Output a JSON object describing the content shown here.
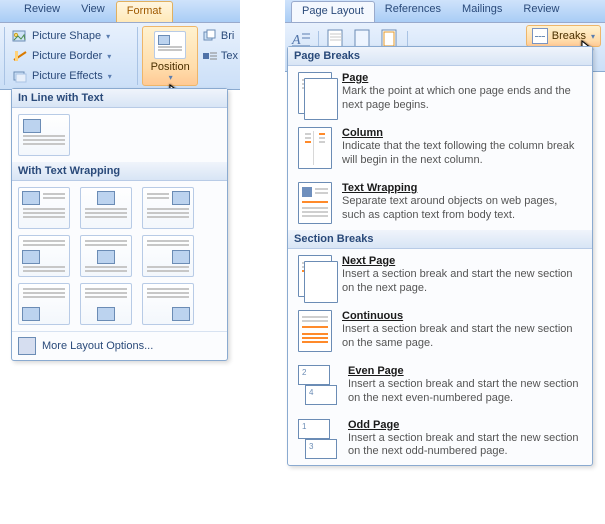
{
  "left": {
    "tabs": {
      "review": "Review",
      "view": "View",
      "format": "Format"
    },
    "picture": {
      "shape": "Picture Shape",
      "border": "Picture Border",
      "effects": "Picture Effects"
    },
    "position_btn": "Position",
    "trail": {
      "bri": "Bri",
      "tex": "Tex"
    },
    "panel": {
      "inline": "In Line with Text",
      "wrap": "With Text Wrapping",
      "more": "More Layout Options..."
    }
  },
  "right": {
    "tabs": {
      "page_layout": "Page Layout",
      "references": "References",
      "mailings": "Mailings",
      "review": "Review"
    },
    "breaks_btn": "Breaks",
    "groups": {
      "page_breaks": "Page Breaks",
      "section_breaks": "Section Breaks"
    },
    "items": {
      "page": {
        "title": "Page",
        "desc": "Mark the point at which one page ends and the next page begins."
      },
      "column": {
        "title": "Column",
        "desc": "Indicate that the text following the column break will begin in the next column."
      },
      "textwrap": {
        "title": "Text Wrapping",
        "desc": "Separate text around objects on web pages, such as caption text from body text."
      },
      "nextpage": {
        "title": "Next Page",
        "desc": "Insert a section break and start the new section on the next page."
      },
      "continuous": {
        "title": "Continuous",
        "desc": "Insert a section break and start the new section on the same page."
      },
      "evenpage": {
        "title": "Even Page",
        "desc": "Insert a section break and start the new section on the next even-numbered page."
      },
      "oddpage": {
        "title": "Odd Page",
        "desc": "Insert a section break and start the new section on the next odd-numbered page."
      },
      "page_nums": {
        "even2": "2",
        "even4": "4",
        "odd1": "1",
        "odd3": "3"
      }
    }
  }
}
